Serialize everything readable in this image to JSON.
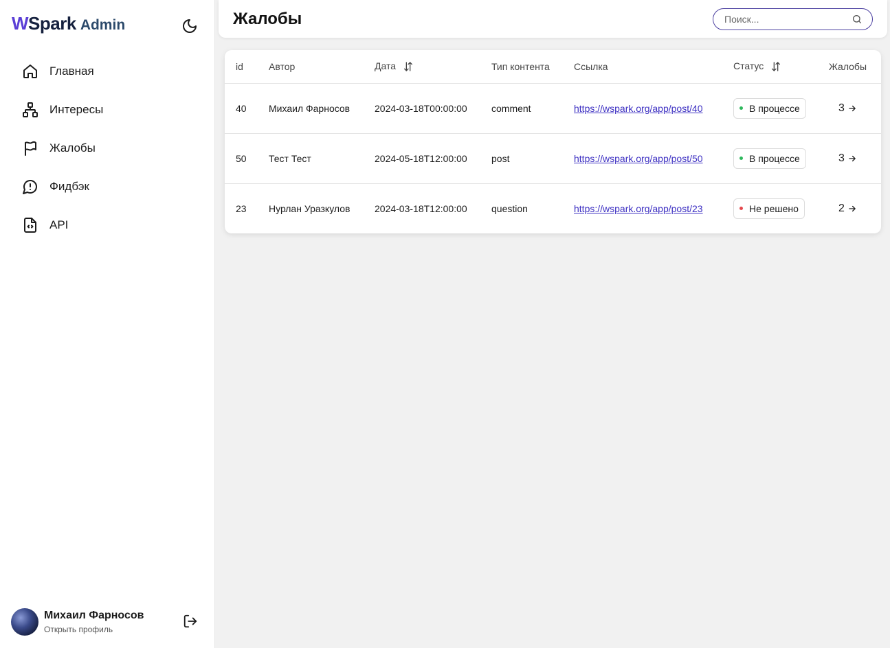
{
  "app": {
    "logo_w": "W",
    "logo_rest": "Spark",
    "logo_sub": "Admin"
  },
  "nav": {
    "items": [
      {
        "label": "Главная",
        "icon": "home-icon"
      },
      {
        "label": "Интересы",
        "icon": "sitemap-icon"
      },
      {
        "label": "Жалобы",
        "icon": "flag-icon"
      },
      {
        "label": "Фидбэк",
        "icon": "message-alert-icon"
      },
      {
        "label": "API",
        "icon": "file-code-icon"
      }
    ]
  },
  "profile": {
    "name": "Михаил Фарносов",
    "link": "Открыть профиль"
  },
  "header": {
    "title": "Жалобы",
    "search_placeholder": "Поиск..."
  },
  "colors": {
    "accent": "#4b3fa0",
    "link": "#3c2fc2",
    "status_in_progress": "#2eb85c",
    "status_unresolved": "#e5484d"
  },
  "table": {
    "columns": {
      "id": "id",
      "author": "Автор",
      "date": "Дата",
      "type": "Тип контента",
      "link": "Ссылка",
      "status": "Статус",
      "count": "Жалобы"
    },
    "rows": [
      {
        "id": "40",
        "author": "Михаил Фарносов",
        "date": "2024-03-18T00:00:00",
        "type": "comment",
        "link": "https://wspark.org/app/post/40",
        "status": "В процессе",
        "status_kind": "in_progress",
        "count": "3"
      },
      {
        "id": "50",
        "author": "Тест Тест",
        "date": "2024-05-18T12:00:00",
        "type": "post",
        "link": "https://wspark.org/app/post/50",
        "status": "В процессе",
        "status_kind": "in_progress",
        "count": "3"
      },
      {
        "id": "23",
        "author": "Нурлан Уразкулов",
        "date": "2024-03-18T12:00:00",
        "type": "question",
        "link": "https://wspark.org/app/post/23",
        "status": "Не решено",
        "status_kind": "unresolved",
        "count": "2"
      }
    ]
  }
}
